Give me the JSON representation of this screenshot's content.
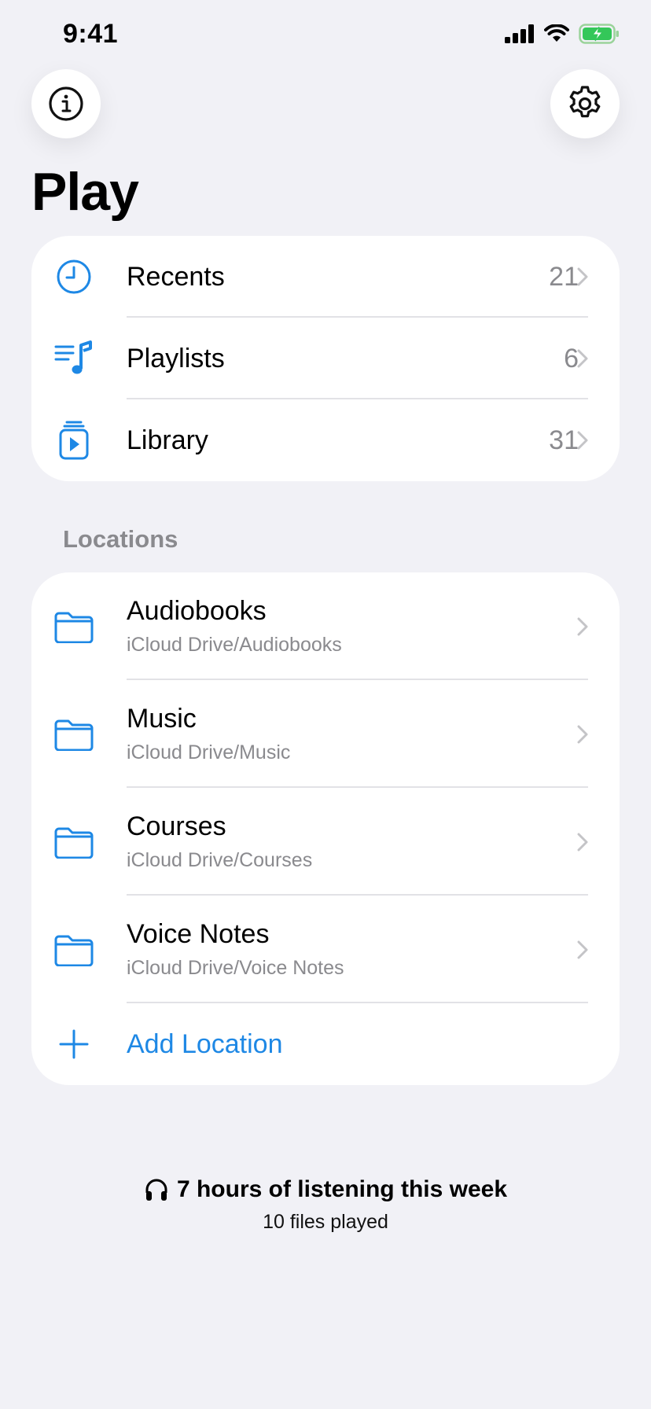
{
  "status_bar": {
    "time": "9:41"
  },
  "header": {
    "title": "Play"
  },
  "main_list": [
    {
      "label": "Recents",
      "count": "21",
      "icon": "clock-icon"
    },
    {
      "label": "Playlists",
      "count": "6",
      "icon": "music-list-icon"
    },
    {
      "label": "Library",
      "count": "31",
      "icon": "library-play-icon"
    }
  ],
  "locations": {
    "header": "Locations",
    "items": [
      {
        "label": "Audiobooks",
        "path": "iCloud Drive/Audiobooks",
        "icon": "folder-icon"
      },
      {
        "label": "Music",
        "path": "iCloud Drive/Music",
        "icon": "folder-icon"
      },
      {
        "label": "Courses",
        "path": "iCloud Drive/Courses",
        "icon": "folder-icon"
      },
      {
        "label": "Voice Notes",
        "path": "iCloud Drive/Voice Notes",
        "icon": "folder-icon"
      }
    ],
    "add_label": "Add Location"
  },
  "footer": {
    "listening": "7 hours of listening this week",
    "files": "10 files played",
    "icon": "headphones-icon"
  },
  "colors": {
    "accent": "#1e88e5",
    "background": "#f1f1f6",
    "secondary_text": "#8a8a8e"
  }
}
